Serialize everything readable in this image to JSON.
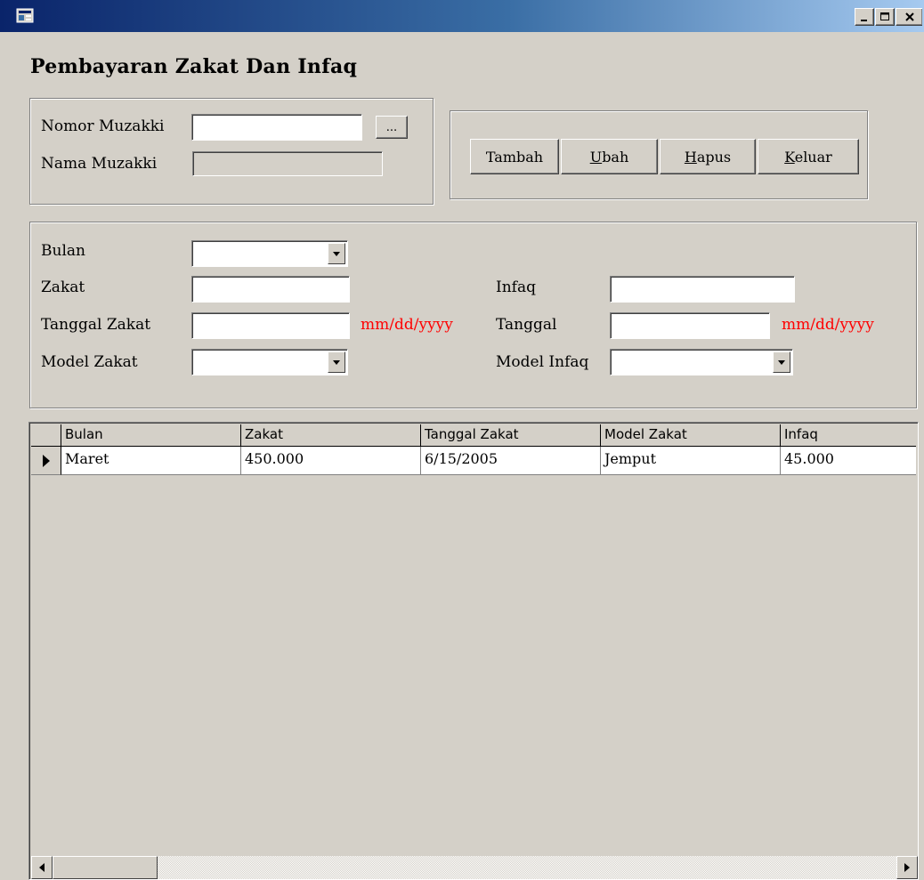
{
  "window": {
    "title": "",
    "minimize_label": "_",
    "maximize_label": "□",
    "close_label": "×"
  },
  "form": {
    "title": "Pembayaran Zakat Dan Infaq"
  },
  "muzakki": {
    "nomor_label": "Nomor Muzakki",
    "nomor_value": "",
    "lookup_label": "...",
    "nama_label": "Nama Muzakki",
    "nama_value": ""
  },
  "actions": {
    "tambah": "Tambah",
    "ubah_first": "U",
    "ubah_rest": "bah",
    "hapus_first": "H",
    "hapus_rest": "apus",
    "keluar_first": "K",
    "keluar_rest": "eluar"
  },
  "details": {
    "bulan_label": "Bulan",
    "bulan_value": "",
    "zakat_label": "Zakat",
    "zakat_value": "",
    "tanggal_zakat_label": "Tanggal Zakat",
    "tanggal_zakat_value": "",
    "tanggal_zakat_hint": "mm/dd/yyyy",
    "model_zakat_label": "Model Zakat",
    "model_zakat_value": "",
    "infaq_label": "Infaq",
    "infaq_value": "",
    "tanggal_label": "Tanggal",
    "tanggal_value": "",
    "tanggal_hint": "mm/dd/yyyy",
    "model_infaq_label": "Model Infaq",
    "model_infaq_value": ""
  },
  "grid": {
    "columns": [
      "Bulan",
      "Zakat",
      "Tanggal Zakat",
      "Model Zakat",
      "Infaq"
    ],
    "rows": [
      [
        "Maret",
        "450.000",
        "6/15/2005",
        "Jemput",
        "45.000"
      ]
    ]
  }
}
